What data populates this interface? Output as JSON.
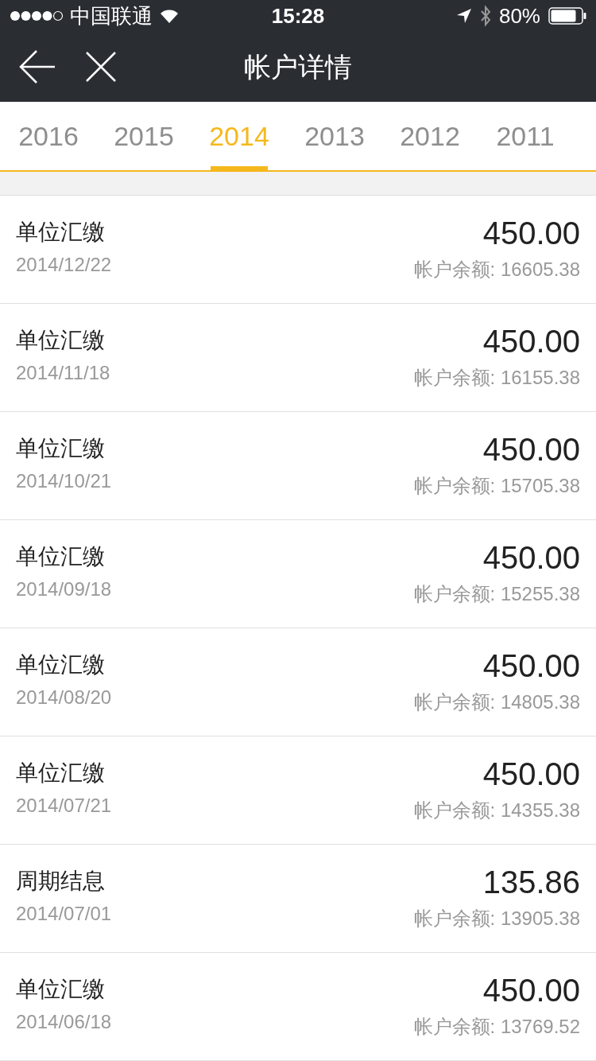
{
  "status_bar": {
    "carrier": "中国联通",
    "time": "15:28",
    "battery": "80%"
  },
  "nav": {
    "title": "帐户详情"
  },
  "tabs": [
    {
      "label": "2016",
      "selected": false
    },
    {
      "label": "2015",
      "selected": false
    },
    {
      "label": "2014",
      "selected": true
    },
    {
      "label": "2013",
      "selected": false
    },
    {
      "label": "2012",
      "selected": false
    },
    {
      "label": "2011",
      "selected": false
    }
  ],
  "records": [
    {
      "type": "单位汇缴",
      "date": "2014/12/22",
      "amount": "450.00",
      "balance": "帐户余额: 16605.38"
    },
    {
      "type": "单位汇缴",
      "date": "2014/11/18",
      "amount": "450.00",
      "balance": "帐户余额: 16155.38"
    },
    {
      "type": "单位汇缴",
      "date": "2014/10/21",
      "amount": "450.00",
      "balance": "帐户余额: 15705.38"
    },
    {
      "type": "单位汇缴",
      "date": "2014/09/18",
      "amount": "450.00",
      "balance": "帐户余额: 15255.38"
    },
    {
      "type": "单位汇缴",
      "date": "2014/08/20",
      "amount": "450.00",
      "balance": "帐户余额: 14805.38"
    },
    {
      "type": "单位汇缴",
      "date": "2014/07/21",
      "amount": "450.00",
      "balance": "帐户余额: 14355.38"
    },
    {
      "type": "周期结息",
      "date": "2014/07/01",
      "amount": "135.86",
      "balance": "帐户余额: 13905.38"
    },
    {
      "type": "单位汇缴",
      "date": "2014/06/18",
      "amount": "450.00",
      "balance": "帐户余额: 13769.52"
    }
  ]
}
